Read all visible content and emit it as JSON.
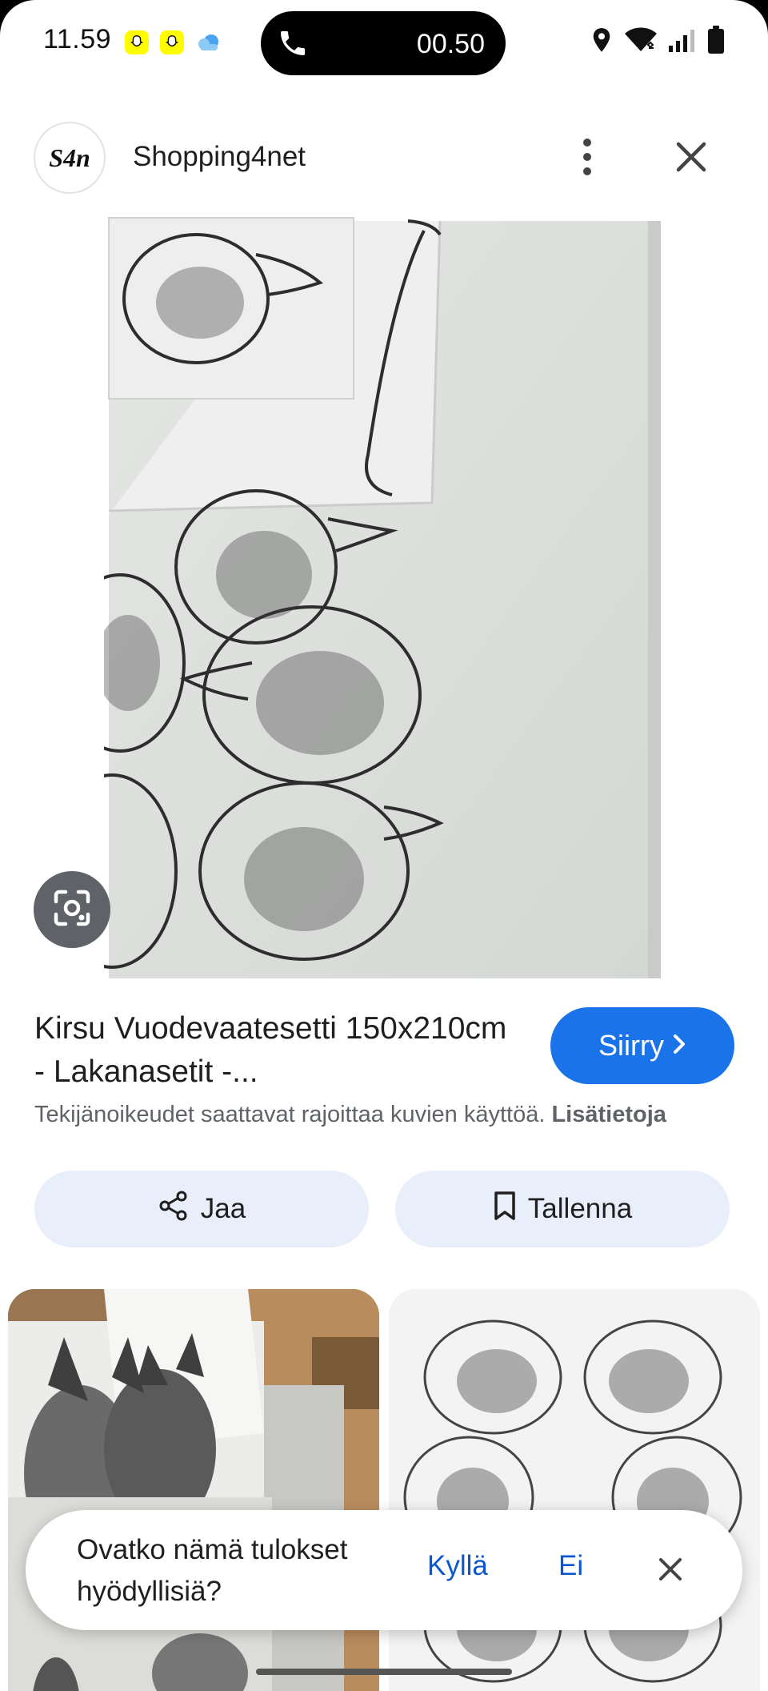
{
  "status_bar": {
    "time": "11.59",
    "call_timer": "00.50"
  },
  "header": {
    "logo_text": "S4n",
    "site_name": "Shopping4net"
  },
  "product": {
    "title": "Kirsu Vuodevaatesetti 150x210cm - Lakanasetit -...",
    "visit_label": "Siirry",
    "copyright_text": "Tekijänoikeudet saattavat rajoittaa kuvien käyttöä.",
    "more_info_label": "Lisätietoja"
  },
  "actions": {
    "share_label": "Jaa",
    "save_label": "Tallenna"
  },
  "feedback": {
    "question": "Ovatko nämä tulokset hyödyllisiä?",
    "yes_label": "Kyllä",
    "no_label": "Ei"
  },
  "colors": {
    "accent": "#1a73e8",
    "link": "#0b57d0",
    "chip_bg": "#e8eefa"
  },
  "icons": [
    "snapchat-icon",
    "cloud-icon",
    "phone-icon",
    "location-icon",
    "wifi-icon",
    "signal-icon",
    "battery-icon",
    "more-vert-icon",
    "close-icon",
    "lens-icon",
    "chevron-right-icon",
    "share-icon",
    "bookmark-icon"
  ]
}
